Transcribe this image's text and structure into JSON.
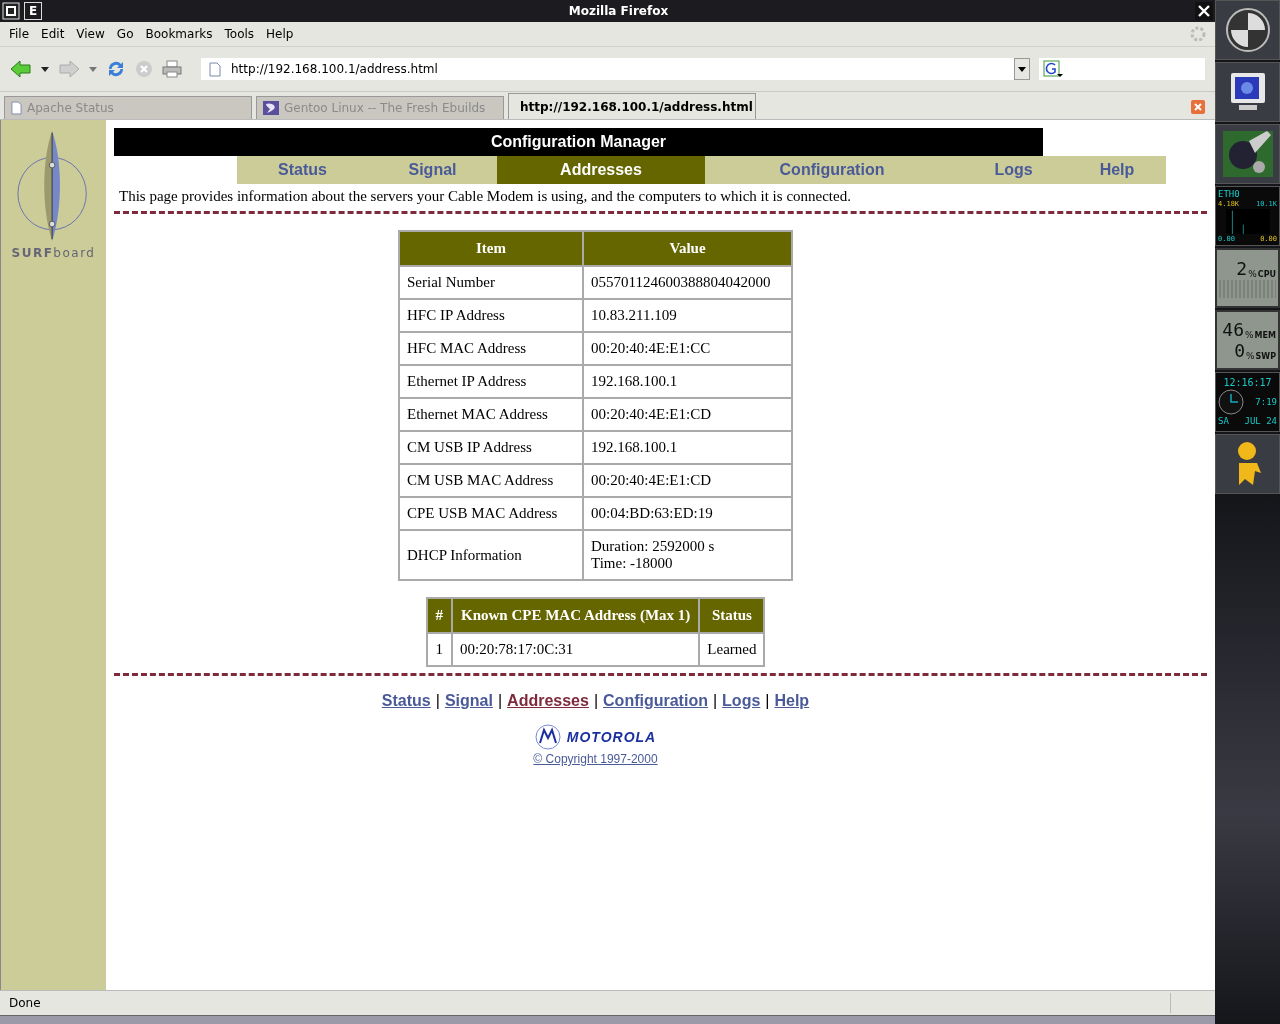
{
  "window": {
    "title": "Mozilla Firefox",
    "menu_letter": "E"
  },
  "menu": [
    "File",
    "Edit",
    "View",
    "Go",
    "Bookmarks",
    "Tools",
    "Help"
  ],
  "address_bar": {
    "value": "http://192.168.100.1/address.html"
  },
  "tabs": [
    {
      "label": "Apache Status",
      "selected": false
    },
    {
      "label": "Gentoo Linux -- The Fresh Ebuilds",
      "selected": false
    },
    {
      "label": "http://192.168.100.1/address.html",
      "selected": true
    }
  ],
  "sidebar": {
    "brand": "**SURF**board"
  },
  "page": {
    "header": "Configuration Manager",
    "nav": [
      {
        "label": "Status",
        "selected": false
      },
      {
        "label": "Signal",
        "selected": false
      },
      {
        "label": "Addresses",
        "selected": true
      },
      {
        "label": "Configuration",
        "selected": false
      },
      {
        "label": "Logs",
        "selected": false
      },
      {
        "label": "Help",
        "selected": false
      }
    ],
    "description": "This page provides information about the servers your Cable Modem is using, and the computers to which it is connected.",
    "table": {
      "columns": [
        "Item",
        "Value"
      ],
      "rows": [
        {
          "item": "Serial Number",
          "value": [
            "055701124600388804042000"
          ]
        },
        {
          "item": "HFC IP Address",
          "value": [
            "10.83.211.109"
          ]
        },
        {
          "item": "HFC MAC Address",
          "value": [
            "00:20:40:4E:E1:CC"
          ]
        },
        {
          "item": "Ethernet IP Address",
          "value": [
            "192.168.100.1"
          ]
        },
        {
          "item": "Ethernet MAC Address",
          "value": [
            "00:20:40:4E:E1:CD"
          ]
        },
        {
          "item": "CM USB IP Address",
          "value": [
            "192.168.100.1"
          ]
        },
        {
          "item": "CM USB MAC Address",
          "value": [
            "00:20:40:4E:E1:CD"
          ]
        },
        {
          "item": "CPE USB MAC Address",
          "value": [
            "00:04:BD:63:ED:19"
          ]
        },
        {
          "item": "DHCP Information",
          "value": [
            "Duration: 2592000 s",
            "Time: -18000"
          ]
        }
      ]
    },
    "cpe_table": {
      "columns": [
        "#",
        "Known CPE MAC Address (Max 1)",
        "Status"
      ],
      "rows": [
        [
          "1",
          "00:20:78:17:0C:31",
          "Learned"
        ]
      ]
    },
    "footer_links": [
      {
        "label": "Status",
        "selected": false
      },
      {
        "label": "Signal",
        "selected": false
      },
      {
        "label": "Addresses",
        "selected": true
      },
      {
        "label": "Configuration",
        "selected": false
      },
      {
        "label": "Logs",
        "selected": false
      },
      {
        "label": "Help",
        "selected": false
      }
    ],
    "footer_separator": "|",
    "brand": "MOTOROLA",
    "copyright": "© Copyright 1997-2000"
  },
  "status_bar": {
    "text": "Done"
  },
  "dock": {
    "net": {
      "label": "ETH0",
      "rx_rate": "4.18K",
      "tx_rate": "10.1K",
      "rx_total": "0.00",
      "tx_total": "0.00"
    },
    "cpu": {
      "value": "2",
      "unit": "%",
      "label": "CPU"
    },
    "memory": {
      "value": "46",
      "unit": "%",
      "label": "MEM"
    },
    "swap": {
      "value": "0",
      "unit": "%",
      "label": "SWP"
    },
    "clock": {
      "time": "12:16:17",
      "short_time": "7:19",
      "day": "SA",
      "date": "JUL 24"
    }
  }
}
